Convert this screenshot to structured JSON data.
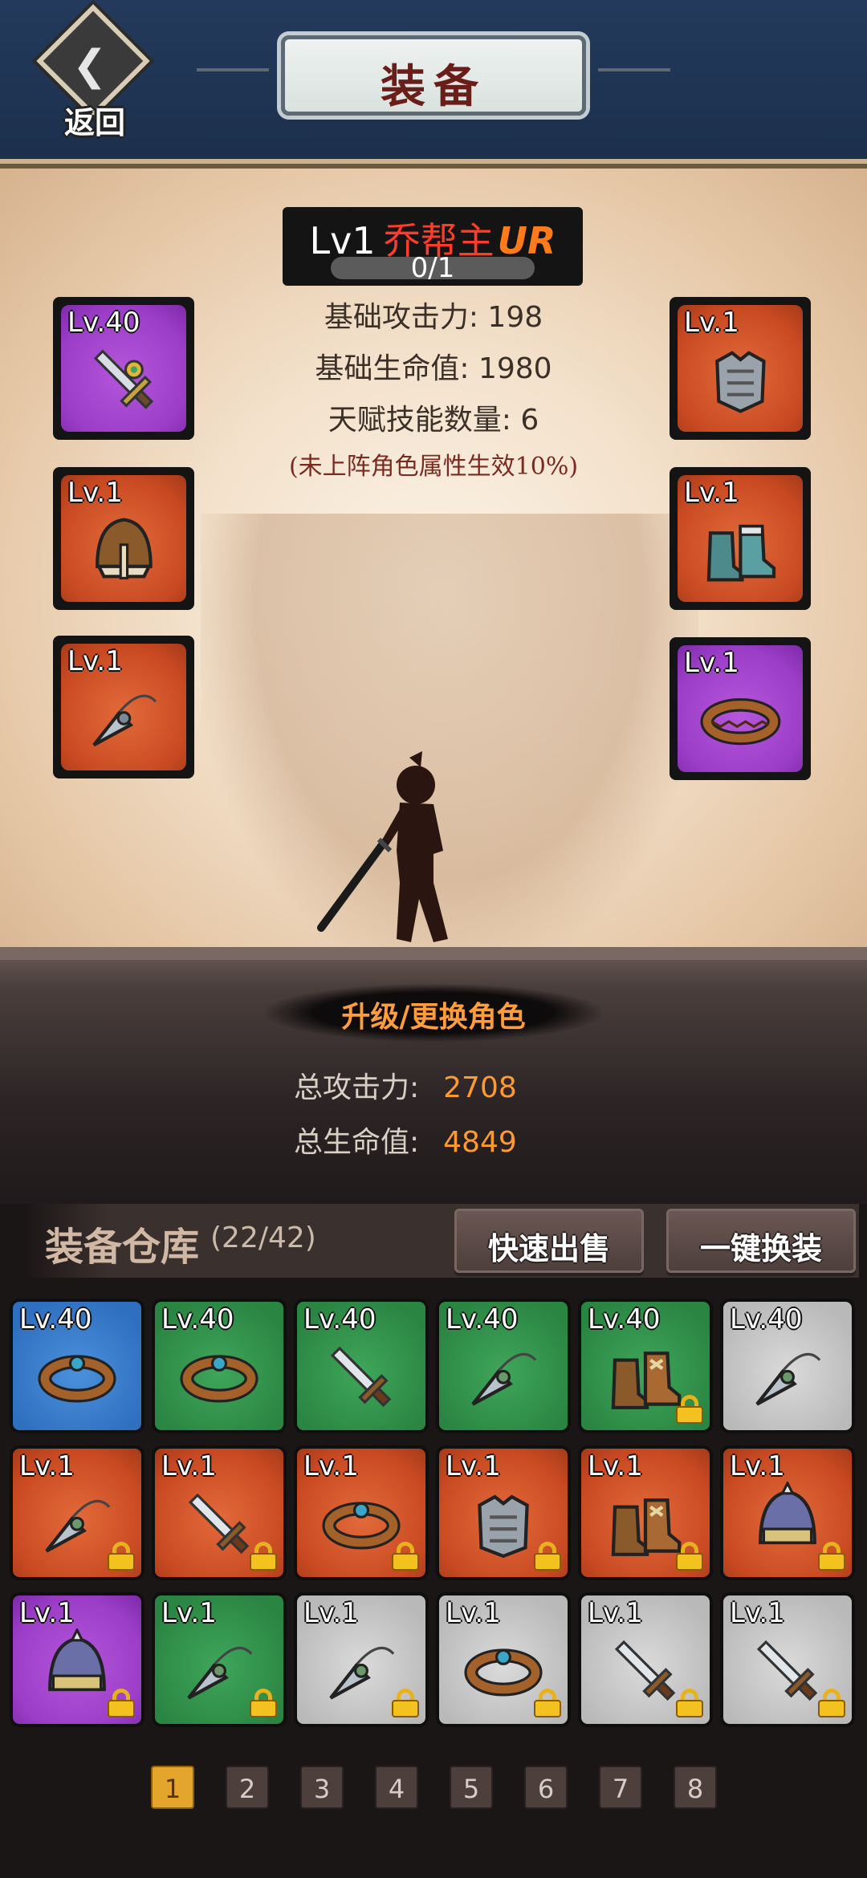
{
  "header": {
    "back_label": "返回",
    "title": "装备"
  },
  "hero": {
    "level": "Lv1",
    "name": "乔帮主",
    "rank": "UR",
    "progress_text": "0/1",
    "progress": 0,
    "stats": {
      "attack": "基础攻击力: 198",
      "hp": "基础生命值: 1980",
      "talents": "天赋技能数量: 6",
      "note": "(未上阵角色属性生效10%)"
    },
    "upgrade_label": "升级/更换角色",
    "total_attack_label": "总攻击力:",
    "total_attack_value": "2708",
    "total_hp_label": "总生命值:",
    "total_hp_value": "4849"
  },
  "equipped": {
    "left": [
      {
        "level": "Lv.40",
        "quality": "purple",
        "icon": "sword-icon"
      },
      {
        "level": "Lv.1",
        "quality": "orange",
        "icon": "helmet-icon"
      },
      {
        "level": "Lv.1",
        "quality": "orange",
        "icon": "necklace-icon"
      }
    ],
    "right": [
      {
        "level": "Lv.1",
        "quality": "orange",
        "icon": "armor-icon"
      },
      {
        "level": "Lv.1",
        "quality": "orange",
        "icon": "boots-icon"
      },
      {
        "level": "Lv.1",
        "quality": "purple",
        "icon": "ring-icon"
      }
    ]
  },
  "warehouse": {
    "title": "装备仓库",
    "count": "(22/42)",
    "quick_sell": "快速出售",
    "one_click_equip": "一键换装",
    "items": [
      {
        "level": "Lv.40",
        "quality": "blue",
        "icon": "ring-icon",
        "locked": false
      },
      {
        "level": "Lv.40",
        "quality": "green",
        "icon": "ring-icon",
        "locked": false
      },
      {
        "level": "Lv.40",
        "quality": "green",
        "icon": "sword-icon",
        "locked": false
      },
      {
        "level": "Lv.40",
        "quality": "green",
        "icon": "necklace-icon",
        "locked": false
      },
      {
        "level": "Lv.40",
        "quality": "green",
        "icon": "boots-icon",
        "locked": true
      },
      {
        "level": "Lv.40",
        "quality": "white",
        "icon": "necklace-icon",
        "locked": false
      },
      {
        "level": "Lv.1",
        "quality": "orange",
        "icon": "necklace-icon",
        "locked": true
      },
      {
        "level": "Lv.1",
        "quality": "orange",
        "icon": "sword-icon",
        "locked": true
      },
      {
        "level": "Lv.1",
        "quality": "orange",
        "icon": "ring-icon",
        "locked": true
      },
      {
        "level": "Lv.1",
        "quality": "orange",
        "icon": "armor-icon",
        "locked": true
      },
      {
        "level": "Lv.1",
        "quality": "orange",
        "icon": "boots-icon",
        "locked": true
      },
      {
        "level": "Lv.1",
        "quality": "orange",
        "icon": "helmet-icon",
        "locked": true
      },
      {
        "level": "Lv.1",
        "quality": "purple",
        "icon": "helmet-icon",
        "locked": true
      },
      {
        "level": "Lv.1",
        "quality": "green",
        "icon": "necklace-icon",
        "locked": true
      },
      {
        "level": "Lv.1",
        "quality": "white",
        "icon": "necklace-icon",
        "locked": true
      },
      {
        "level": "Lv.1",
        "quality": "white",
        "icon": "ring-icon",
        "locked": true
      },
      {
        "level": "Lv.1",
        "quality": "white",
        "icon": "sword-icon",
        "locked": true
      },
      {
        "level": "Lv.1",
        "quality": "white",
        "icon": "sword-icon",
        "locked": true
      }
    ]
  },
  "pager": {
    "pages": [
      "1",
      "2",
      "3",
      "4",
      "5",
      "6",
      "7",
      "8"
    ],
    "active": 0
  },
  "colors": {
    "header_bg": "#233a5c",
    "accent_orange": "#ff9a2e",
    "hero_name": "#ff3b2a",
    "quality_orange": "#c94a22",
    "quality_purple": "#9b3dc7",
    "quality_blue": "#2f6fbf",
    "quality_green": "#2a8542",
    "quality_white": "#b9b9b9"
  }
}
